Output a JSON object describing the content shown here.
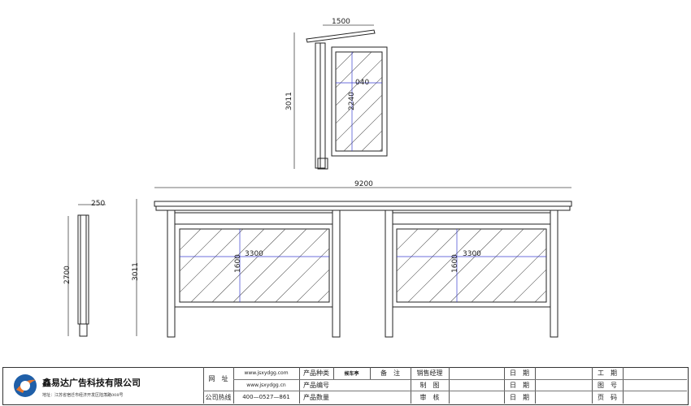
{
  "dimensions": {
    "top_width": "1500",
    "top_height": "3011",
    "top_panel_height": "2240",
    "top_panel_width": "040",
    "overall_width": "9200",
    "side_depth": "250",
    "side_height": "2700",
    "front_height": "3011",
    "panel_left_width": "3300",
    "panel_left_height": "1600",
    "panel_right_width": "3300",
    "panel_right_height": "1600"
  },
  "title_block": {
    "company_name": "鑫易达广告科技有限公司",
    "company_address": "地址：江苏省宿迁市经济开发区陆荡路008号",
    "website_label": "网　址",
    "website_1": "www.jsxydgg.com",
    "website_2": "www.jsxydgg.cn",
    "hotline_label": "公司热线",
    "hotline": "400—0527—861",
    "product_type_label": "产品种类",
    "product_type": "候车亭",
    "product_code_label": "产品编号",
    "product_qty_label": "产品数量",
    "remarks_label": "备　注",
    "sales_manager_label": "销售经理",
    "draw_label": "制　图",
    "review_label": "审　核",
    "date_label_1": "日　期",
    "date_label_2": "日　期",
    "date_label_3": "日　期",
    "period_label": "工　期",
    "drawing_no_label": "图　号",
    "page_label": "页　码"
  },
  "colors": {
    "line": "#222222",
    "dimension": "#3b3fd1",
    "logo_blue": "#1f5fa8",
    "logo_orange": "#e8772e"
  }
}
